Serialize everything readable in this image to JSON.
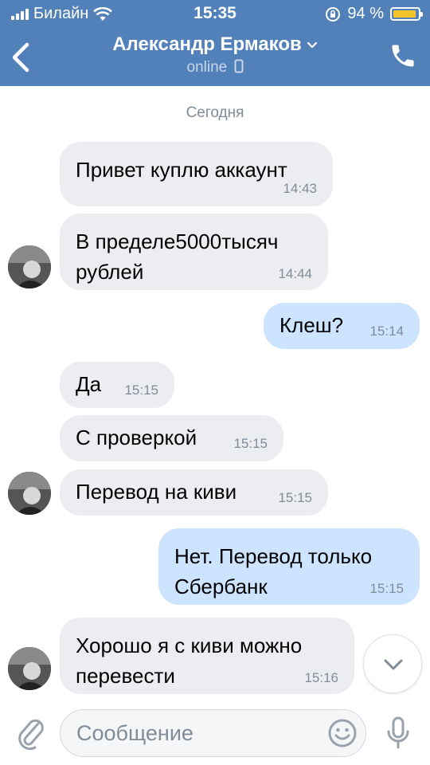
{
  "status_bar": {
    "carrier": "Билайн",
    "time": "15:35",
    "battery_percent": "94 %",
    "battery_level": 0.94
  },
  "header": {
    "title": "Александр Ермаков",
    "subtitle": "online"
  },
  "chat": {
    "date_separator": "Сегодня",
    "messages": [
      {
        "text": "Привет куплю аккаунт",
        "time": "14:43"
      },
      {
        "text": "В пределе5000тысяч\nрублей",
        "time": "14:44"
      },
      {
        "text": "Клеш?",
        "time": "15:14"
      },
      {
        "text": "Да",
        "time": "15:15"
      },
      {
        "text": "С проверкой",
        "time": "15:15"
      },
      {
        "text": "Перевод на киви",
        "time": "15:15"
      },
      {
        "text": "Нет. Перевод только\nСбербанк",
        "time": "15:15"
      },
      {
        "text": "Хорошо я с киви можно\nперевести",
        "time": "15:16"
      }
    ]
  },
  "composer": {
    "placeholder": "Сообщение"
  },
  "colors": {
    "header_bg": "#5181b8",
    "incoming_bubble": "#ebedf0",
    "outgoing_bubble": "#cce4ff",
    "battery": "#f6c32a"
  },
  "icons": [
    "signal-icon",
    "wifi-icon",
    "rotation-lock-icon",
    "battery-icon",
    "back-arrow-icon",
    "chevron-down-icon",
    "mobile-icon",
    "phone-icon",
    "scroll-down-icon",
    "attach-icon",
    "emoji-icon",
    "microphone-icon"
  ]
}
